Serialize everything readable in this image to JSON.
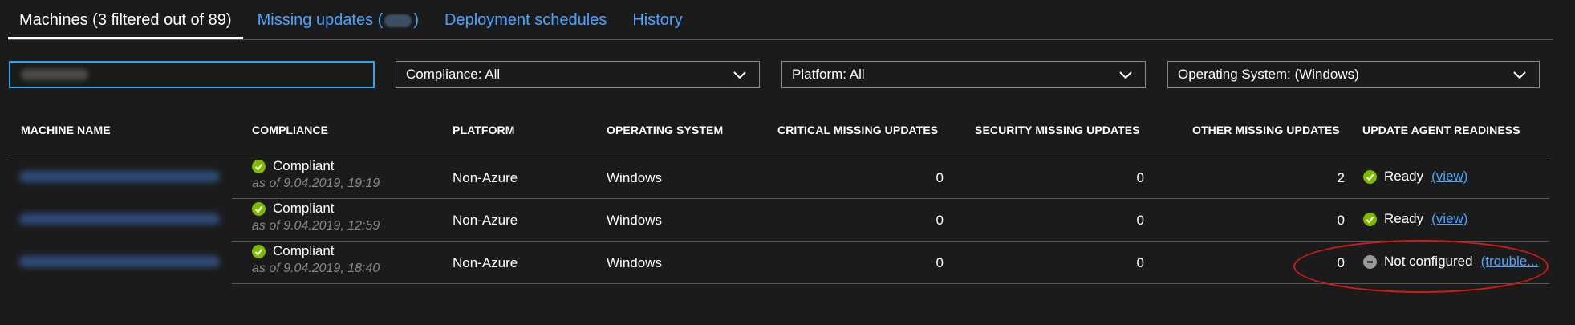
{
  "tabs": [
    {
      "label": "Machines (3 filtered out of 89)",
      "active": true
    },
    {
      "label_prefix": "Missing updates (",
      "label_suffix": ")",
      "active": false
    },
    {
      "label": "Deployment schedules",
      "active": false
    },
    {
      "label": "History",
      "active": false
    }
  ],
  "filters": {
    "compliance": "Compliance: All",
    "platform": "Platform: All",
    "os": "Operating System: (Windows)"
  },
  "table": {
    "headers": {
      "machine_name": "MACHINE NAME",
      "compliance": "COMPLIANCE",
      "platform": "PLATFORM",
      "os": "OPERATING SYSTEM",
      "critical": "CRITICAL MISSING UPDATES",
      "security": "SECURITY MISSING UPDATES",
      "other": "OTHER MISSING UPDATES",
      "readiness": "UPDATE AGENT READINESS"
    },
    "rows": [
      {
        "compliance": "Compliant",
        "date": "as of 9.04.2019, 19:19",
        "platform": "Non-Azure",
        "os": "Windows",
        "critical": "0",
        "security": "0",
        "other": "2",
        "readiness": "Ready",
        "link": "(view)"
      },
      {
        "compliance": "Compliant",
        "date": "as of 9.04.2019, 12:59",
        "platform": "Non-Azure",
        "os": "Windows",
        "critical": "0",
        "security": "0",
        "other": "0",
        "readiness": "Ready",
        "link": "(view)"
      },
      {
        "compliance": "Compliant",
        "date": "as of 9.04.2019, 18:40",
        "platform": "Non-Azure",
        "os": "Windows",
        "critical": "0",
        "security": "0",
        "other": "0",
        "readiness": "Not configured",
        "link": "(trouble..."
      }
    ]
  },
  "colors": {
    "accent": "#4da3ff",
    "ok": "#7fba00",
    "notconfigured": "#9a9a9a",
    "annotation": "#d11a1a"
  }
}
